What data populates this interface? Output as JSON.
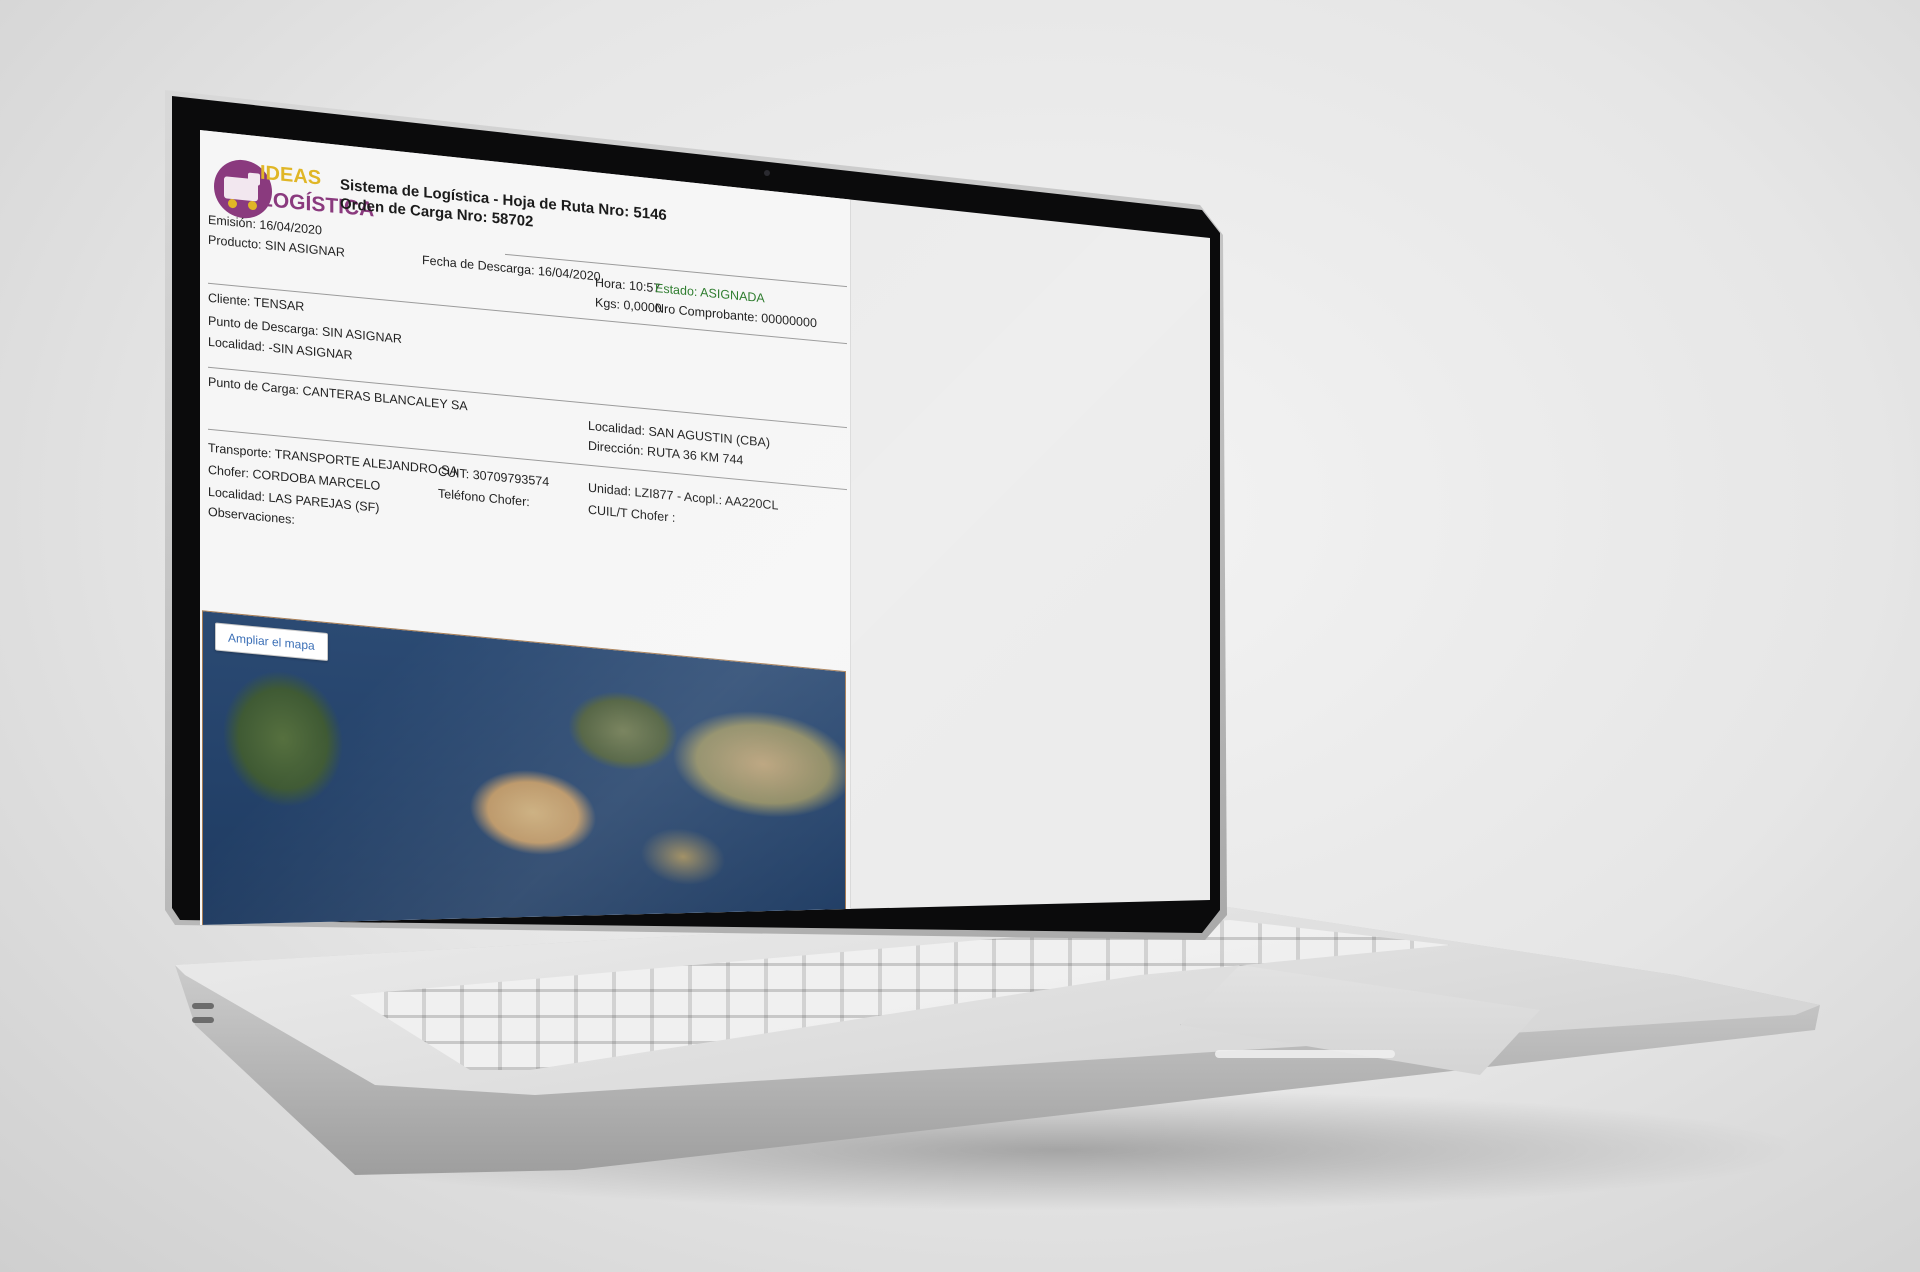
{
  "header": {
    "logo_top": "IDEAS",
    "logo_bottom": "LOGÍSTICA",
    "title_line1": "Sistema de Logística - Hoja de Ruta Nro: 5146",
    "title_line2": "Orden de Carga Nro: 58702"
  },
  "summary": {
    "emision": "Emisión: 16/04/2020",
    "producto": "Producto: SIN ASIGNAR",
    "fecha_descarga": "Fecha de Descarga: 16/04/2020",
    "hora": "Hora: 10:57",
    "estado": "Estado: ASIGNADA",
    "kgs": "Kgs: 0,0000",
    "nro_comprobante": "Nro Comprobante: 00000000"
  },
  "cliente": {
    "cliente": "Cliente: TENSAR",
    "punto_descarga": "Punto de Descarga: SIN ASIGNAR",
    "localidad": "Localidad: -SIN ASIGNAR"
  },
  "carga": {
    "punto_carga": "Punto de Carga: CANTERAS BLANCALEY SA",
    "localidad": "Localidad: SAN AGUSTIN (CBA)",
    "direccion": "Dirección: RUTA 36 KM 744"
  },
  "transporte": {
    "transporte": "Transporte: TRANSPORTE ALEJANDRO SA",
    "cuit": "CUIT: 30709793574",
    "unidad": "Unidad: LZI877 - Acopl.: AA220CL",
    "chofer": "Chofer: CORDOBA MARCELO",
    "telefono_chofer": "Teléfono Chofer:",
    "cuil_chofer": "CUIL/T Chofer :",
    "localidad": "Localidad: LAS PAREJAS (SF)",
    "observaciones": "Observaciones:"
  },
  "map": {
    "button_label": "Ampliar el mapa"
  },
  "colors": {
    "logo_purple": "#8a3a7e",
    "logo_yellow": "#e0b626",
    "status_green": "#2f7d2f",
    "link_blue": "#3b6fb6"
  }
}
